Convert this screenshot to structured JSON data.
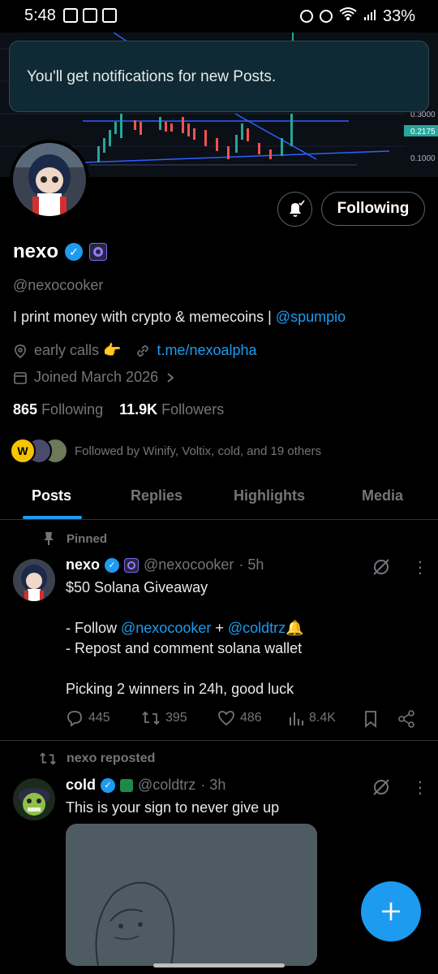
{
  "status_bar": {
    "time": "5:48",
    "battery": "33%"
  },
  "toast": {
    "message": "You'll get notifications for new Posts."
  },
  "banner": {
    "price_labels": [
      "0.3000",
      "0.2175",
      "0.1000"
    ]
  },
  "profile": {
    "following_button": "Following",
    "name": "nexo",
    "handle": "@nexocooker",
    "bio_text": "I print money with crypto & memecoins | ",
    "bio_mention": "@spumpio",
    "location": "early calls 👉",
    "website": "t.me/nexoalpha",
    "joined": "Joined March 2026",
    "following_count": "865",
    "following_label": "Following",
    "followers_count": "11.9K",
    "followers_label": "Followers",
    "followed_by": "Followed by Winify, Voltix, cold, and 19 others"
  },
  "tabs": [
    {
      "label": "Posts"
    },
    {
      "label": "Replies"
    },
    {
      "label": "Highlights"
    },
    {
      "label": "Media"
    }
  ],
  "pinned_post": {
    "pinned_label": "Pinned",
    "name": "nexo",
    "handle": "@nexocooker",
    "time": "· 5h",
    "line1": "$50 Solana Giveaway",
    "line2_prefix": "- Follow ",
    "line2_mention1": "@nexocooker",
    "line2_plus": " + ",
    "line2_mention2": "@coldtrz",
    "line2_emoji": "🔔",
    "line3": "- Repost and comment solana wallet",
    "line4": "Picking 2 winners in 24h, good luck",
    "replies": "445",
    "reposts": "395",
    "likes": "486",
    "views": "8.4K"
  },
  "repost": {
    "reposted_label": "nexo reposted",
    "name": "cold",
    "handle": "@coldtrz",
    "time": "· 3h",
    "text": "This is your sign to never give up"
  },
  "colors": {
    "accent": "#1d9bf0",
    "muted": "#71767b",
    "border": "#2f3336",
    "toast_bg": "#0f2a34"
  }
}
